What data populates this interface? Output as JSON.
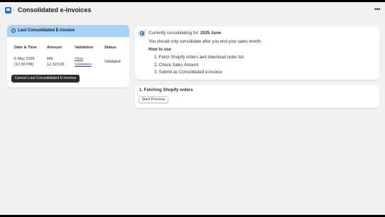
{
  "header": {
    "title": "Consolidated e-invoices",
    "breadcrumb_separator": "›",
    "more_label": "•••"
  },
  "last_invoice": {
    "title": "Last Consolidated E-invoice",
    "columns": [
      "Date & Time",
      "Amount",
      "Validation",
      "Status"
    ],
    "row": {
      "date_line1": "5 May 2025",
      "date_line2": "(12:30 PM)",
      "amount_line1": "RM",
      "amount_line2": "12,323.00",
      "validation_line1": "View",
      "validation_line2": "Validation",
      "status": "Validated"
    },
    "cancel_label": "Cancel Last Consolidated E-invoice"
  },
  "consolidating": {
    "prefix": "Currently consolidating for: ",
    "period": "2025 June",
    "note": "You should only consolidate after you end your sales month.",
    "how_to_title": "How to use",
    "steps": [
      "1. Fetch Shopify orders and download order list.",
      "2. Check Sales Amount",
      "3. Submit as Consolidated e-invoice"
    ]
  },
  "fetching": {
    "title": "1. Fetching Shopify orders",
    "start_label": "Start Process"
  }
}
